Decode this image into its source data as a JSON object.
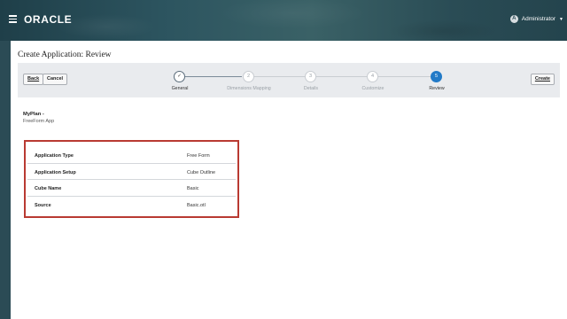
{
  "header": {
    "brand": "ORACLE",
    "user_initial": "A",
    "user_name": "Administrator",
    "menu_icon": "hamburger-icon",
    "caret_icon": "chevron-down-icon",
    "colors": {
      "banner": "#2b4b55",
      "accent": "#227ac7",
      "highlight_border": "#b93a32"
    }
  },
  "page": {
    "title": "Create Application: Review"
  },
  "toolbar": {
    "back_label": "Back",
    "cancel_label": "Cancel",
    "create_label": "Create"
  },
  "train": {
    "steps": [
      {
        "number": "✓",
        "label": "General",
        "state": "complete"
      },
      {
        "number": "2",
        "label": "Dimensions Mapping",
        "state": "pending"
      },
      {
        "number": "3",
        "label": "Details",
        "state": "pending"
      },
      {
        "number": "4",
        "label": "Customize",
        "state": "pending"
      },
      {
        "number": "5",
        "label": "Review",
        "state": "current"
      }
    ]
  },
  "summary": {
    "app_name": "MyPlan -",
    "app_desc": "FreeForm App"
  },
  "review_table": {
    "rows": [
      {
        "label": "Application Type",
        "value": "Free Form"
      },
      {
        "label": "Application Setup",
        "value": "Cube Outline"
      },
      {
        "label": "Cube Name",
        "value": "Basic"
      },
      {
        "label": "Source",
        "value": "Basic.otl"
      }
    ]
  }
}
